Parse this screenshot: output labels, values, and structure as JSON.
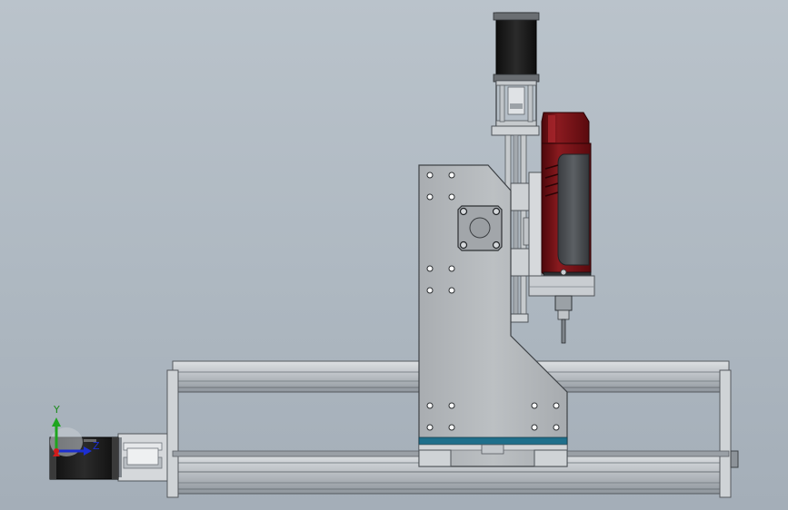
{
  "view": {
    "background_top": "#bac3cb",
    "background_bottom": "#a4aeb8"
  },
  "colors": {
    "frame_aluminum": "#c9cdd1",
    "frame_shadow": "#8e959c",
    "gantry_plate": "#b3b7ba",
    "motor_body": "#1d1d1d",
    "spindle_red": "#7a1216",
    "spindle_dark": "#4b4e52",
    "accent_blue": "#1f6f8b",
    "axis_y": "#1fa51f",
    "axis_z": "#1c2fd1",
    "axis_x": "#d11c1c"
  },
  "triad": {
    "y_label": "Y",
    "z_label": "Z"
  },
  "icons": {
    "triad": "coordinate-triad-icon"
  }
}
